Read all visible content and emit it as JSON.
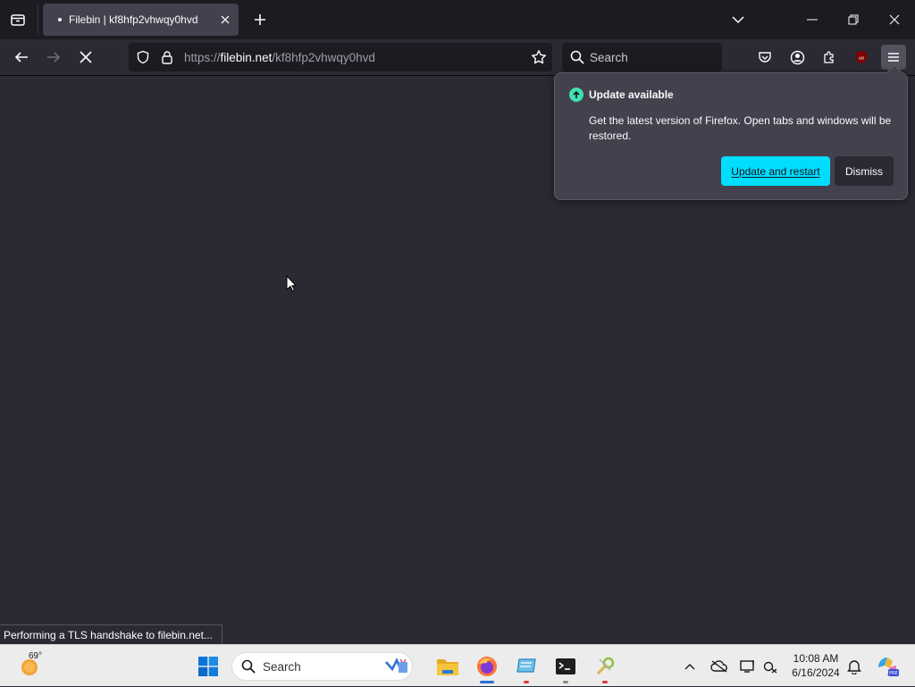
{
  "browser": {
    "tab": {
      "title": "Filebin | kf8hfp2vhwqy0hvd"
    },
    "url": {
      "scheme": "https://",
      "host": "filebin.net",
      "path": "/kf8hfp2vhwqy0hvd"
    },
    "search_placeholder": "Search"
  },
  "update_popup": {
    "heading": "Update available",
    "message": "Get the latest version of Firefox. Open tabs and windows will be restored.",
    "primary_label": "Update and restart",
    "secondary_label": "Dismiss"
  },
  "status_text": "Performing a TLS handshake to filebin.net...",
  "taskbar": {
    "weather_temp": "69°",
    "search_placeholder": "Search",
    "time": "10:08 AM",
    "date": "6/16/2024"
  },
  "colors": {
    "accent": "#00ddff",
    "update_badge": "#3fe1b0",
    "content_bg": "#2b2a33",
    "toolbar_bg": "#1c1b22"
  }
}
